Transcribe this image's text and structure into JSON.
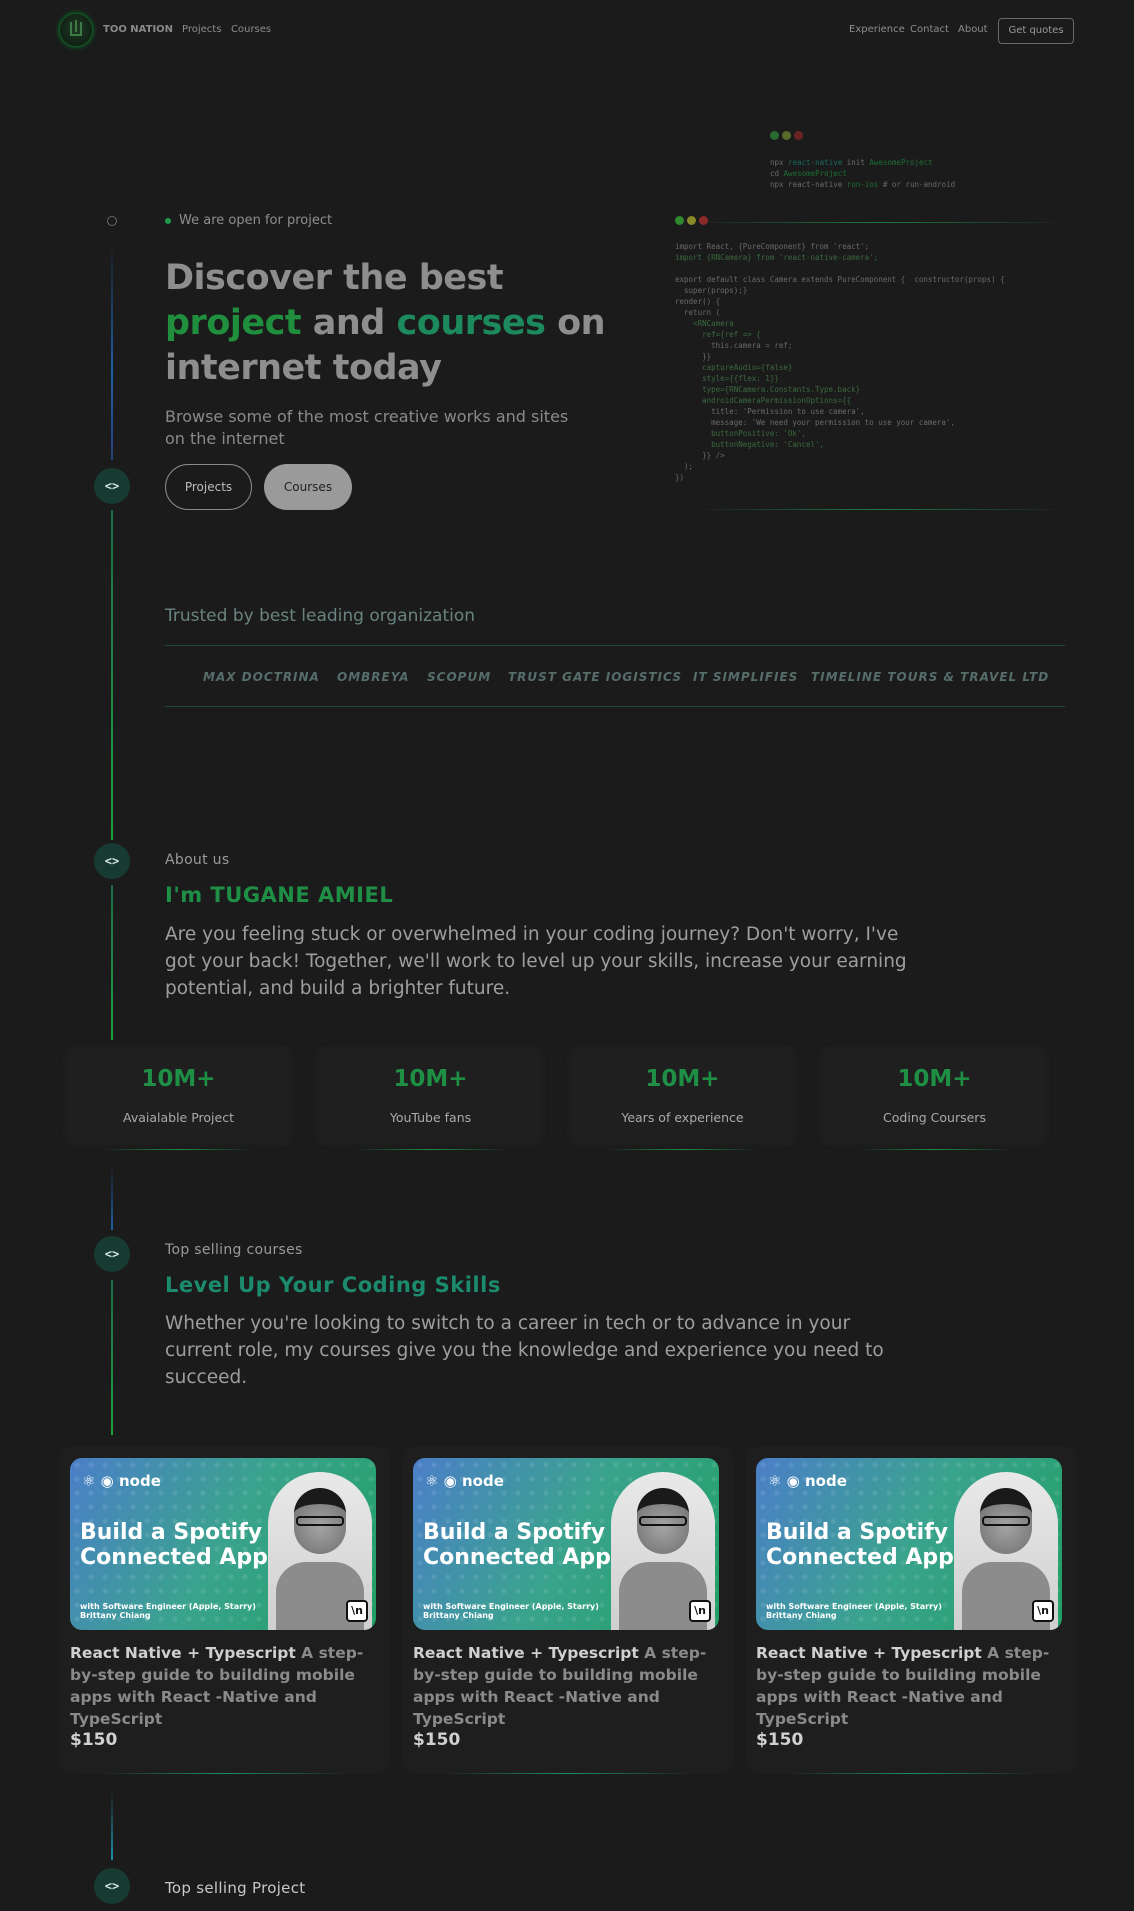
{
  "nav": {
    "brand": "TOO NATION",
    "left_links": [
      "Projects",
      "Courses"
    ],
    "right_links": [
      "Experience",
      "Contact",
      "About"
    ],
    "cta": "Get quotes"
  },
  "hero": {
    "status": "We are open for project",
    "title_a": "Discover the best ",
    "title_b": "project",
    "title_c": " and ",
    "title_d": "courses",
    "title_e": " on internet today",
    "subtitle": "Browse some of the most creative works and sites on the internet",
    "btn_projects": "Projects",
    "btn_courses": "Courses",
    "timeline_icon": "<>"
  },
  "code_back": {
    "l1a": "npx ",
    "l1b": "react-native",
    "l1c": " init ",
    "l1d": "AwesomeProject",
    "l2a": "cd ",
    "l2b": "AwesomeProject",
    "l3a": "npx react-native ",
    "l3b": "run-ios",
    "l3c": " # or run-android"
  },
  "code_front": {
    "lines": [
      "import React, {PureComponent} from 'react';",
      "import {RNCamera} from 'react-native-camera';",
      "",
      "export default class Camera extends PureComponent {  constructor(props) {",
      "  super(props);}",
      "render() {",
      "  return (",
      "    <RNCamera",
      "      ref={ref => {",
      "        this.camera = ref;",
      "      }}",
      "      captureAudio={false}",
      "      style={{flex: 1}}",
      "      type={RNCamera.Constants.Type.back}",
      "      androidCameraPermissionOptions={{",
      "        title: 'Permission to use camera',",
      "        message: 'We need your permission to use your camera',",
      "        buttonPositive: 'Ok',",
      "        buttonNegative: 'Cancel',",
      "      }} />",
      "  );",
      "})"
    ]
  },
  "trusted": {
    "title": "Trusted by best leading organization",
    "logos": [
      "MAX DOCTRINA",
      "OMBREYA",
      "SCOPUM",
      "TRUST GATE IOGISTICS",
      "IT SIMPLIFIES",
      "TIMELINE TOURS & TRAVEL LTD"
    ]
  },
  "about": {
    "eyebrow": "About us",
    "heading": "I'm TUGANE AMIEL",
    "paragraph": "Are you feeling stuck or overwhelmed in your coding journey? Don't worry, I've got your back! Together, we'll work to level up your skills, increase your earning potential, and build a brighter future."
  },
  "stats": [
    {
      "value": "10M+",
      "label": "Avaialable Project"
    },
    {
      "value": "10M+",
      "label": "YouTube fans"
    },
    {
      "value": "10M+",
      "label": "Years of experience"
    },
    {
      "value": "10M+",
      "label": "Coding Coursers"
    }
  ],
  "courses_section": {
    "eyebrow": "Top selling courses",
    "heading": "Level Up Your Coding Skills",
    "paragraph": "Whether you're looking to switch to a career in tech or to advance in your current role, my courses give you the knowledge and experience you need to succeed."
  },
  "course_cards": [
    {
      "thumb_brand": "node",
      "thumb_title": "Build a Spotify Connected App",
      "thumb_with": "with  Software Engineer (Apple, Starry)",
      "thumb_author": "Brittany Chiang",
      "badge": "\\n",
      "title": "React Native + Typescript",
      "desc": " A step-by-step guide to building mobile apps with React -Native and TypeScript",
      "price": "$150"
    },
    {
      "thumb_brand": "node",
      "thumb_title": "Build a Spotify Connected App",
      "thumb_with": "with  Software Engineer (Apple, Starry)",
      "thumb_author": "Brittany Chiang",
      "badge": "\\n",
      "title": "React Native + Typescript",
      "desc": " A step-by-step guide to building mobile apps with React -Native and TypeScript",
      "price": "$150"
    },
    {
      "thumb_brand": "node",
      "thumb_title": "Build a Spotify Connected App",
      "thumb_with": "with  Software Engineer (Apple, Starry)",
      "thumb_author": "Brittany Chiang",
      "badge": "\\n",
      "title": "React Native + Typescript",
      "desc": " A step-by-step guide to building mobile apps with React -Native and TypeScript",
      "price": "$150"
    }
  ],
  "projects_section": {
    "eyebrow": "Top selling Project"
  },
  "colors": {
    "accent_green": "#1e8f45",
    "teal": "#1c8a5c",
    "background": "#1b1b1b"
  }
}
